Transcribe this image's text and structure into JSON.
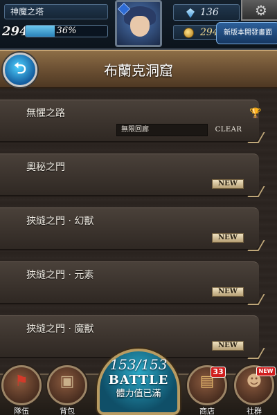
{
  "hud": {
    "game_title": "神魔之塔",
    "level": "294",
    "exp_percent": 36,
    "exp_text": "36%",
    "gems": "136",
    "coins": "294",
    "dev_banner": "新版本開發畫面",
    "icons": {
      "gem": "diamond-icon",
      "coin": "coin-icon",
      "settings": "gear-icon",
      "avatar": "character-portrait"
    }
  },
  "header": {
    "title": "布蘭克洞窟",
    "back_icon": "back-arrow-icon"
  },
  "stages": [
    {
      "name": "無懼之路",
      "sub_label": "無限回廊",
      "status": "CLEAR",
      "has_trophy": true
    },
    {
      "name": "奧秘之門",
      "status": "NEW"
    },
    {
      "name": "狹縫之門 · 幻獸",
      "status": "NEW"
    },
    {
      "name": "狹縫之門 · 元素",
      "status": "NEW"
    },
    {
      "name": "狹縫之門 · 魔獸",
      "status": "NEW"
    }
  ],
  "bottom_nav": {
    "team": {
      "label": "隊伍",
      "icon": "flag-icon"
    },
    "bag": {
      "label": "背包",
      "icon": "backpack-icon"
    },
    "shop": {
      "label": "商店",
      "icon": "treasure-chest-icon",
      "badge": "33"
    },
    "social": {
      "label": "社群",
      "icon": "friends-icon",
      "badge": "NEW"
    },
    "battle": {
      "stamina": "153/153",
      "label": "BATTLE",
      "status": "體力值已滿"
    }
  }
}
